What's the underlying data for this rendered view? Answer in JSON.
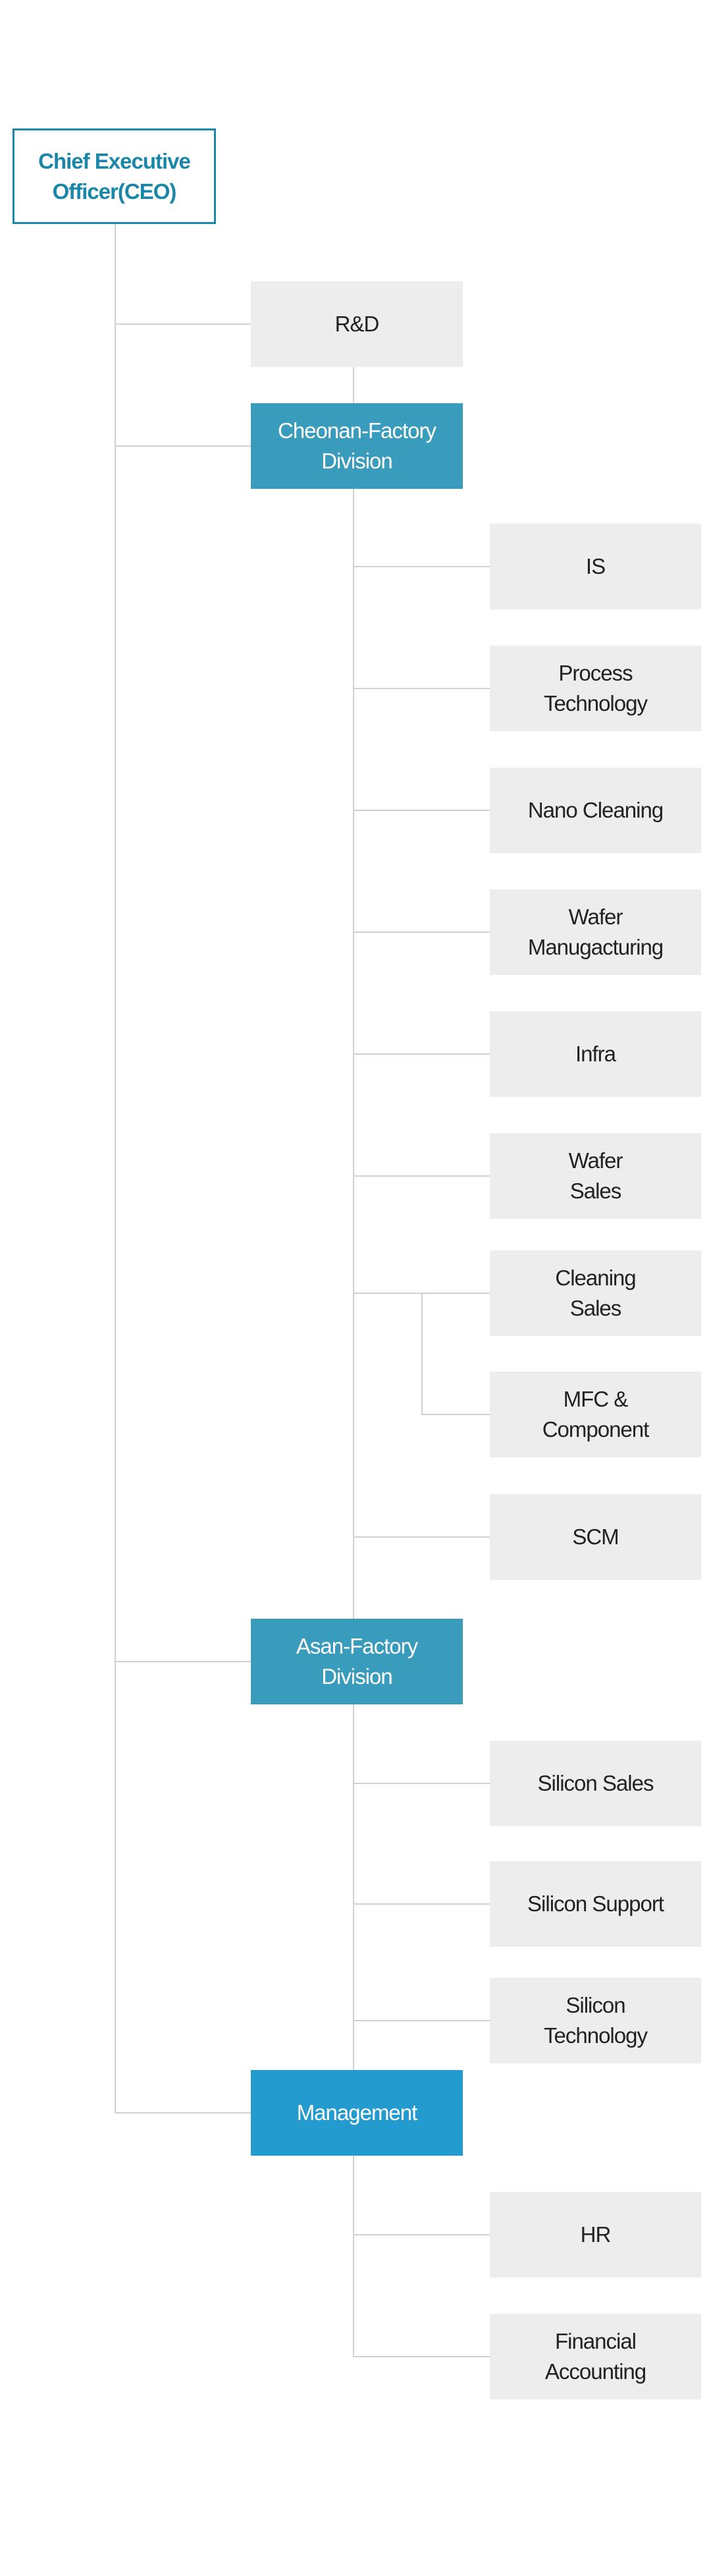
{
  "ceo": {
    "label": "Chief Executive\nOfficer(CEO)"
  },
  "rnd": {
    "label": "R&D"
  },
  "cheonan": {
    "label": "Cheonan-Factory\nDivision",
    "departments": [
      "IS",
      "Process\nTechnology",
      "Nano Cleaning",
      "Wafer\nManugacturing",
      "Infra",
      "Wafer\nSales",
      "Cleaning\nSales",
      "MFC &\nComponent",
      "SCM"
    ]
  },
  "asan": {
    "label": "Asan-Factory\nDivision",
    "departments": [
      "Silicon Sales",
      "Silicon Support",
      "Silicon\nTechnology"
    ]
  },
  "management": {
    "label": "Management",
    "departments": [
      "HR",
      "Financial\nAccounting"
    ]
  },
  "colors": {
    "ceo_border": "#1a8aab",
    "division": "#3a9cbd",
    "management": "#239bcf",
    "department": "#ededed",
    "connector": "#d0d0d0"
  }
}
